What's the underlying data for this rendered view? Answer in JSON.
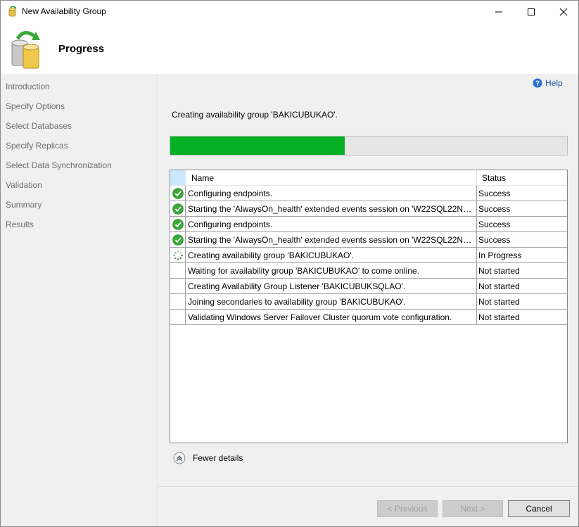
{
  "window": {
    "title": "New Availability Group"
  },
  "header": {
    "title": "Progress"
  },
  "sidebar": {
    "items": [
      {
        "label": "Introduction"
      },
      {
        "label": "Specify Options"
      },
      {
        "label": "Select Databases"
      },
      {
        "label": "Specify Replicas"
      },
      {
        "label": "Select Data Synchronization"
      },
      {
        "label": "Validation"
      },
      {
        "label": "Summary"
      },
      {
        "label": "Results"
      }
    ]
  },
  "main": {
    "help_label": "Help",
    "status_text": "Creating availability group 'BAKICUBUKAO'.",
    "progress_fraction": 0.44,
    "table": {
      "columns": [
        "Name",
        "Status"
      ],
      "rows": [
        {
          "icon": "success-icon",
          "name": "Configuring endpoints.",
          "status": "Success"
        },
        {
          "icon": "success-icon",
          "name": "Starting the 'AlwaysOn_health' extended events session on 'W22SQL22NOD...",
          "status": "Success"
        },
        {
          "icon": "success-icon",
          "name": "Configuring endpoints.",
          "status": "Success"
        },
        {
          "icon": "success-icon",
          "name": "Starting the 'AlwaysOn_health' extended events session on 'W22SQL22NOD...",
          "status": "Success"
        },
        {
          "icon": "spinner-icon",
          "name": "Creating availability group 'BAKICUBUKAO'.",
          "status": "In Progress"
        },
        {
          "icon": "none",
          "name": "Waiting for availability group 'BAKICUBUKAO' to come online.",
          "status": "Not started"
        },
        {
          "icon": "none",
          "name": "Creating Availability Group Listener 'BAKICUBUKSQLAO'.",
          "status": "Not started"
        },
        {
          "icon": "none",
          "name": "Joining secondaries to availability group 'BAKICUBUKAO'.",
          "status": "Not started"
        },
        {
          "icon": "none",
          "name": "Validating Windows Server Failover Cluster quorum vote configuration.",
          "status": "Not started"
        }
      ]
    },
    "fewer_details_label": "Fewer details"
  },
  "footer": {
    "previous_label": "< Previous",
    "next_label": "Next >",
    "cancel_label": "Cancel"
  },
  "colors": {
    "progress_fill": "#06b025",
    "link": "#1c55a5",
    "success": "#3a9a3a"
  }
}
